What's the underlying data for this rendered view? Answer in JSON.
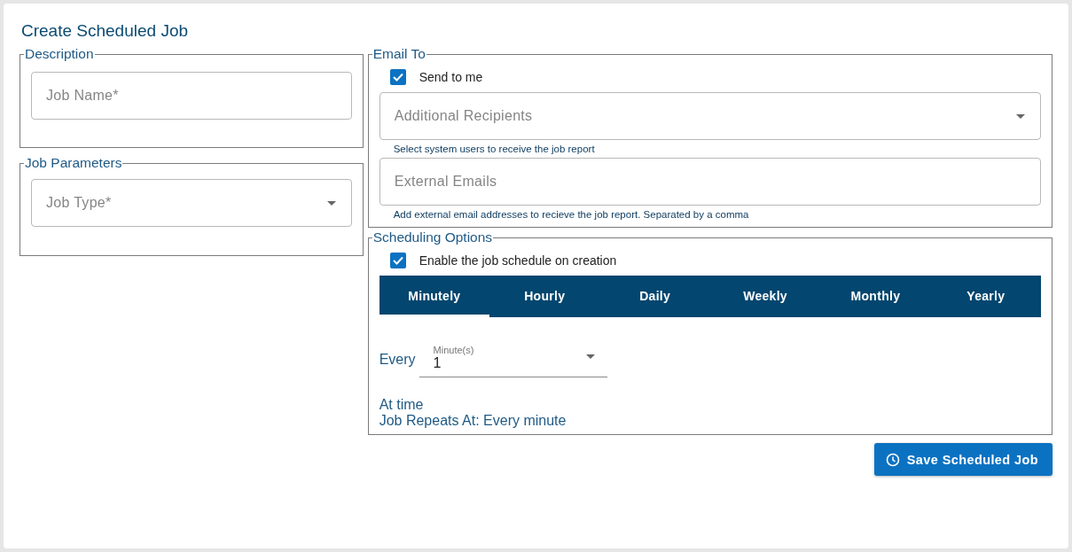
{
  "title": "Create Scheduled Job",
  "description": {
    "legend": "Description",
    "job_name": {
      "placeholder": "Job Name*"
    }
  },
  "job_parameters": {
    "legend": "Job Parameters",
    "job_type": {
      "placeholder": "Job Type*"
    }
  },
  "email_to": {
    "legend": "Email To",
    "send_to_me": {
      "label": "Send to me",
      "checked": true
    },
    "additional_recipients": {
      "placeholder": "Additional Recipients",
      "helper": "Select system users to receive the job report"
    },
    "external_emails": {
      "placeholder": "External Emails",
      "helper": "Add external email addresses to recieve the job report. Separated by a comma"
    }
  },
  "scheduling_options": {
    "legend": "Scheduling Options",
    "enable": {
      "label": "Enable the job schedule on creation",
      "checked": true
    },
    "tabs": [
      {
        "label": "Minutely",
        "selected": true
      },
      {
        "label": "Hourly",
        "selected": false
      },
      {
        "label": "Daily",
        "selected": false
      },
      {
        "label": "Weekly",
        "selected": false
      },
      {
        "label": "Monthly",
        "selected": false
      },
      {
        "label": "Yearly",
        "selected": false
      }
    ],
    "every_label": "Every",
    "minutes": {
      "label": "Minute(s)",
      "value": "1"
    },
    "at_time": "At time",
    "repeats": "Job Repeats At: Every minute"
  },
  "save_button": "Save Scheduled Job"
}
